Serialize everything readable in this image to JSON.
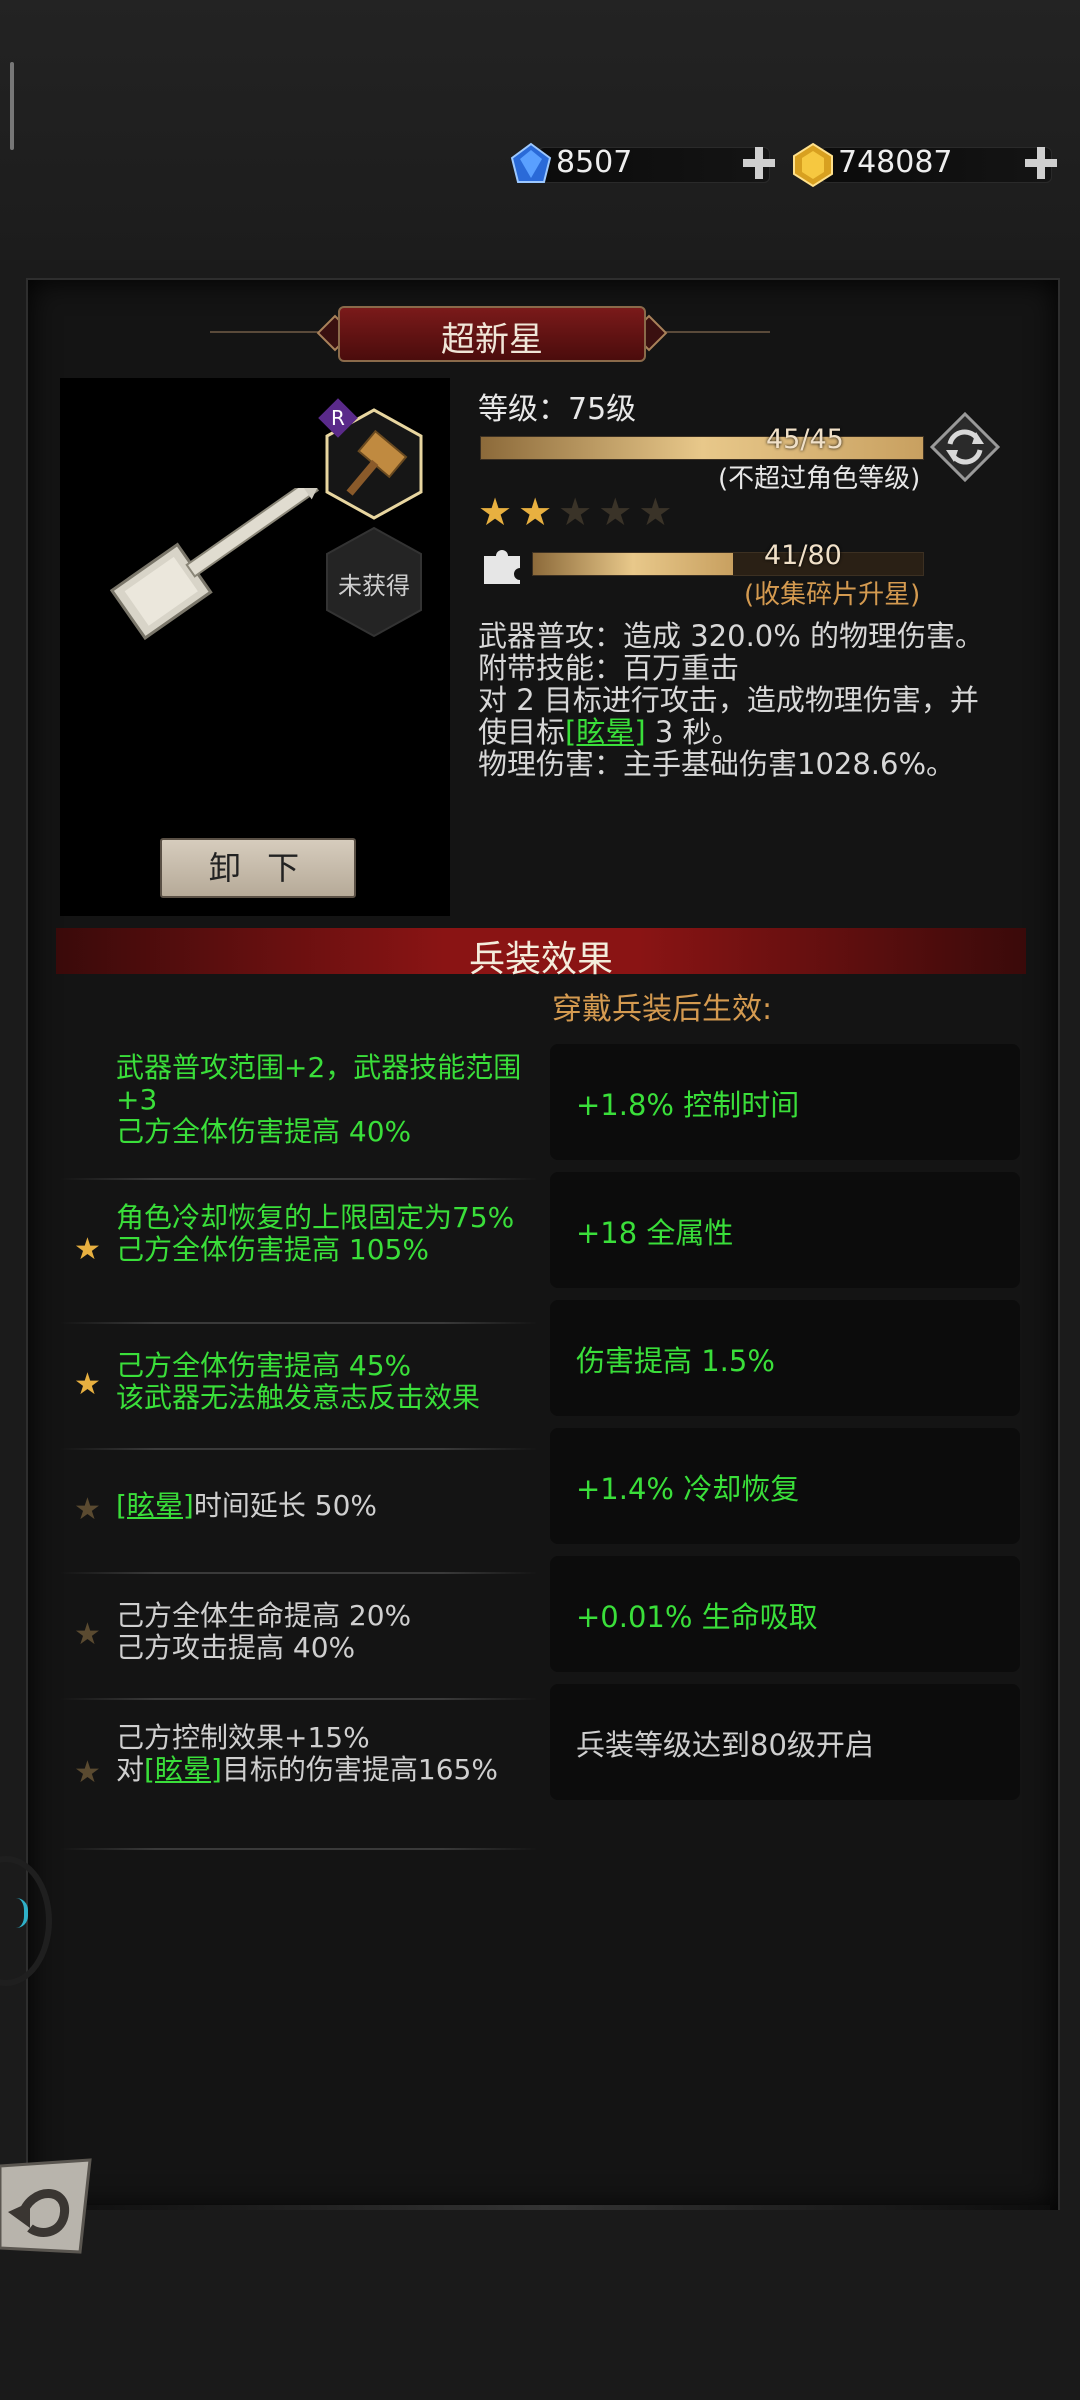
{
  "currency": {
    "gems": "8507",
    "gold": "748087"
  },
  "weapon": {
    "name": "超新星",
    "rarity_badge": "R",
    "unowned_label": "未获得",
    "unequip_label": "卸 下",
    "level_text": "等级：75级",
    "level_progress": "45/45",
    "level_progress_fraction": 1.0,
    "level_note": "(不超过角色等级)",
    "stars_total": 5,
    "stars_lit": 2,
    "fragment_progress": "41/80",
    "fragment_progress_fraction": 0.5125,
    "fragment_note": "(收集碎片升星)",
    "desc": {
      "line1": "武器普攻：造成 320.0% 的物理伤害。",
      "line2": "附带技能：百万重击",
      "line3": "对 2 目标进行攻击，造成物理伤害，并",
      "line4_pre": "使目标",
      "line4_link": "[眩晕]",
      "line4_post": " 3 秒。",
      "line5": "物理伤害：主手基础伤害1028.6%。"
    }
  },
  "effects": {
    "header": "兵装效果",
    "wear_label": "穿戴兵装后生效:",
    "left": [
      {
        "star": "none",
        "text": "武器普攻范围+2，武器技能范围+3\n己方全体伤害提高 40%",
        "color": "green"
      },
      {
        "star": "on",
        "text": "角色冷却恢复的上限固定为75%\n己方全体伤害提高 105%",
        "color": "green"
      },
      {
        "star": "on",
        "text": "己方全体伤害提高 45%\n该武器无法触发意志反击效果",
        "color": "green"
      },
      {
        "star": "off",
        "link": "[眩晕]",
        "text": "时间延长 50%",
        "color": "white"
      },
      {
        "star": "off",
        "text": "己方全体生命提高 20%\n己方攻击提高 40%",
        "color": "white"
      },
      {
        "star": "off",
        "pre": "己方控制效果+15%\n对",
        "link": "[眩晕]",
        "text": "目标的伤害提高165%",
        "color": "white"
      }
    ],
    "right": [
      {
        "text": "+1.8% 控制时间",
        "color": "green"
      },
      {
        "text": "+18 全属性",
        "color": "green"
      },
      {
        "text": "伤害提高 1.5%",
        "color": "green"
      },
      {
        "text": "+1.4% 冷却恢复",
        "color": "green"
      },
      {
        "text": "+0.01% 生命吸取",
        "color": "green"
      },
      {
        "text": "兵装等级达到80级开启",
        "color": "white"
      }
    ]
  }
}
